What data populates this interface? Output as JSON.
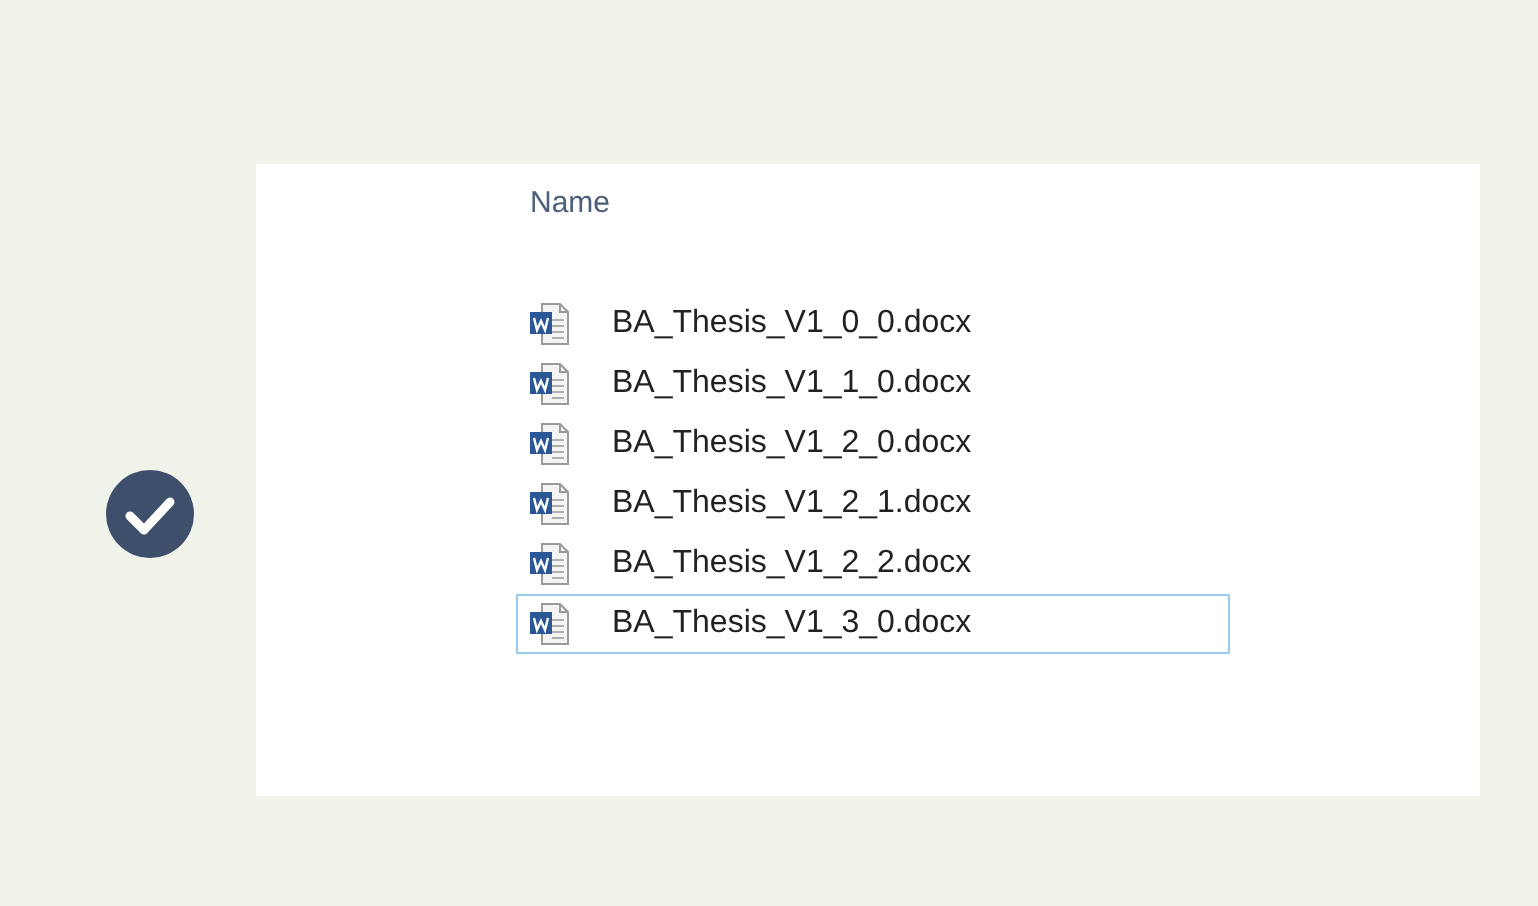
{
  "column_header": "Name",
  "files": [
    {
      "name": "BA_Thesis_V1_0_0.docx",
      "selected": false
    },
    {
      "name": "BA_Thesis_V1_1_0.docx",
      "selected": false
    },
    {
      "name": "BA_Thesis_V1_2_0.docx",
      "selected": false
    },
    {
      "name": "BA_Thesis_V1_2_1.docx",
      "selected": false
    },
    {
      "name": "BA_Thesis_V1_2_2.docx",
      "selected": false
    },
    {
      "name": "BA_Thesis_V1_3_0.docx",
      "selected": true
    }
  ]
}
